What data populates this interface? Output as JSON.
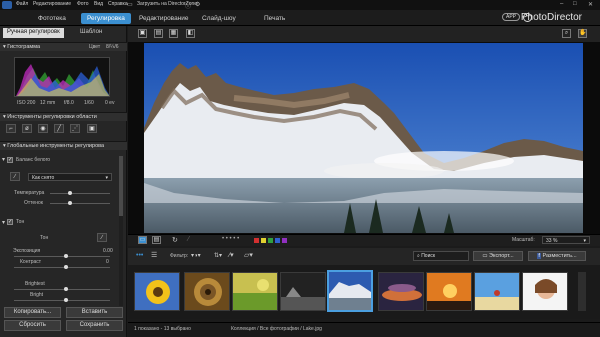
{
  "menu": [
    "Файл",
    "Редактирование",
    "Фото",
    "Вид",
    "Справка"
  ],
  "menu_extra": "Загрузить на DirectorZone",
  "tabs": [
    "Фототека",
    "Регулировка",
    "Редактирование",
    "Слайд-шоу",
    "Печать"
  ],
  "brand": {
    "badge": "APP",
    "name": "PhotoDirector"
  },
  "left": {
    "subtabs": [
      "Ручная регулировк",
      "Шаблон"
    ],
    "histogram": {
      "title": "Гистограмма",
      "color_label": "Цвет",
      "bit_label": "8/¼/6"
    },
    "exif": [
      "ISO 200",
      "12 mm",
      "f/8.0",
      "1/60",
      "0 ev"
    ],
    "region_tools_title": "Инструменты регулировки области",
    "global_tools_title": "Глобальные инструменты регулирова",
    "white_balance": {
      "title": "Баланс белого",
      "preset": "Как снято",
      "temperature_label": "Температура",
      "tint_label": "Оттенок"
    },
    "tone": {
      "title": "Тон",
      "tone_label": "Тон",
      "exposure_label": "Экспозиция",
      "exposure_value": "0.00",
      "contrast_label": "Контраст",
      "contrast_value": "0",
      "brightest_label": "Brightest",
      "bright_label": "Bright"
    },
    "buttons": {
      "copy": "Копировать...",
      "paste": "Вставить",
      "reset": "Сбросить",
      "save": "Сохранить"
    }
  },
  "view_bar": {
    "zoom_label": "Масштаб:",
    "zoom_value": "33 %"
  },
  "browser_bar": {
    "filter_label": "Фильтр:",
    "search_placeholder": "Поиск",
    "export_label": "Экспорт...",
    "share_label": "Разместить..."
  },
  "status": {
    "count": "1 показано - 13 выбрано",
    "path": "Коллекция / Все фотографии / Lake.jpg"
  },
  "colors": {
    "accent": "#3b8fd0",
    "selection": "#4b9fe0"
  },
  "icons": [
    "search-icon",
    "hand-icon",
    "info-icon",
    "gear-icon",
    "minimize-icon",
    "maximize-icon",
    "close-icon"
  ]
}
